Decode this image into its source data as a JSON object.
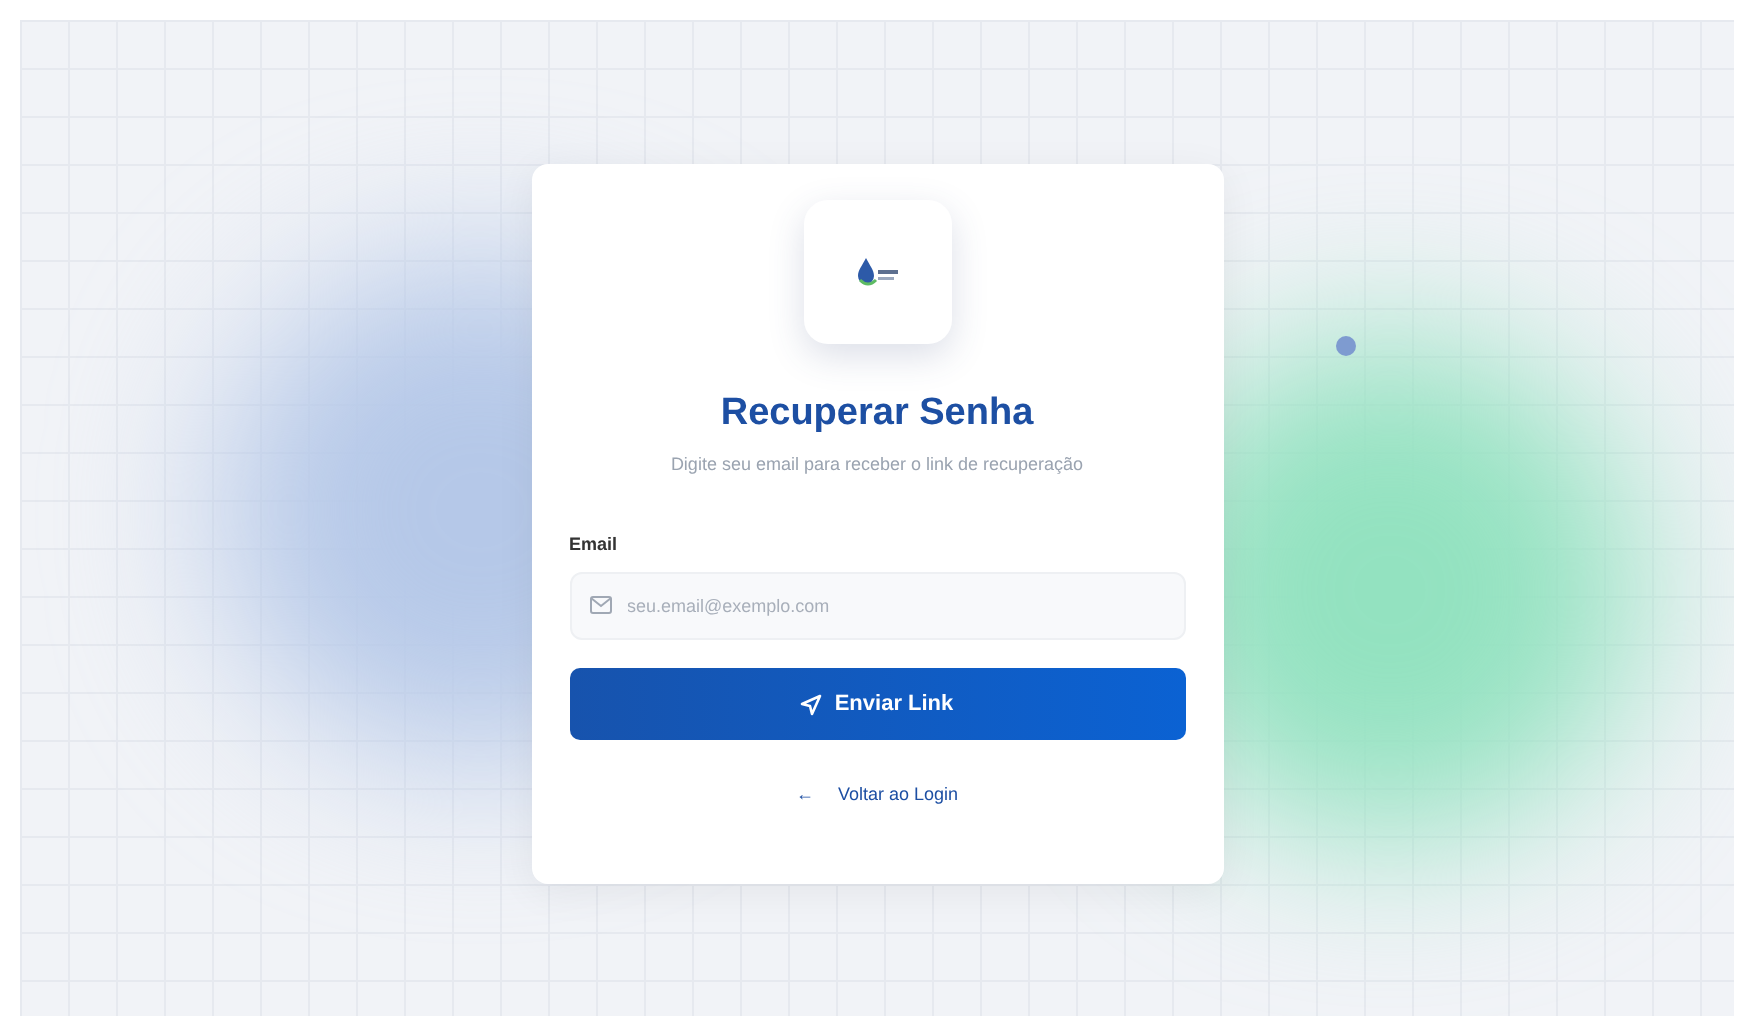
{
  "card": {
    "title": "Recuperar Senha",
    "subtitle": "Digite seu email para receber o link de recuperação"
  },
  "email_field": {
    "label": "Email",
    "placeholder": "seu.email@exemplo.com"
  },
  "submit_button": {
    "label": "Enviar Link"
  },
  "back_link": {
    "arrow": "←",
    "label": "Voltar ao Login"
  }
}
